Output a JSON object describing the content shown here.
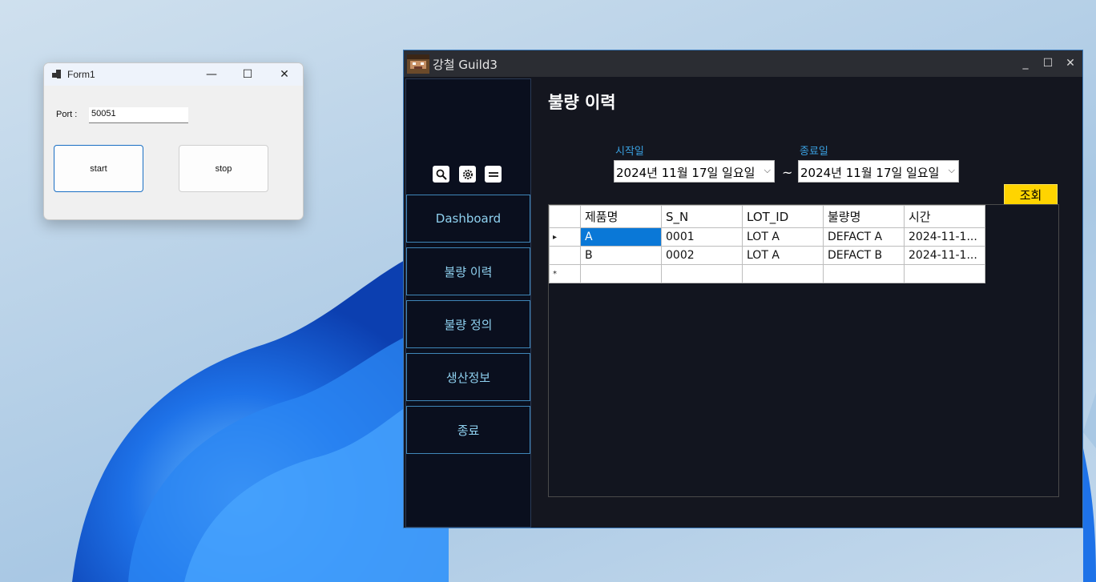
{
  "form1": {
    "title": "Form1",
    "controls": {
      "minimize": "—",
      "maximize": "☐",
      "close": "✕"
    },
    "port_label": "Port :",
    "port_value": "50051",
    "start_label": "start",
    "stop_label": "stop"
  },
  "app": {
    "title": "강철 Guild3",
    "controls": {
      "minimize": "_",
      "maximize": "☐",
      "close": "✕"
    },
    "toolbar_icons": [
      "search-icon",
      "gear-icon",
      "menu-icon"
    ],
    "nav": [
      "Dashboard",
      "불량 이력",
      "불량 정의",
      "생산정보",
      "종료"
    ],
    "page_title": "불량 이력",
    "start_date_label": "시작일",
    "end_date_label": "종료일",
    "start_date": "2024년 11월 17일 일요일",
    "end_date": "2024년 11월 17일 일요일",
    "range_separator": "~",
    "query_button": "조회",
    "grid": {
      "columns": [
        "제품명",
        "S_N",
        "LOT_ID",
        "불량명",
        "시간"
      ],
      "rows": [
        [
          "A",
          "0001",
          "LOT A",
          "DEFACT A",
          "2024-11-1..."
        ],
        [
          "B",
          "0002",
          "LOT A",
          "DEFACT B",
          "2024-11-1..."
        ]
      ],
      "current_row_marker": "▸",
      "new_row_marker": "*"
    },
    "colors": {
      "accent_yellow": "#ffd400",
      "nav_text": "#8fd1f0",
      "label_blue": "#3aa0e0",
      "selected_cell": "#0a78d7"
    }
  }
}
